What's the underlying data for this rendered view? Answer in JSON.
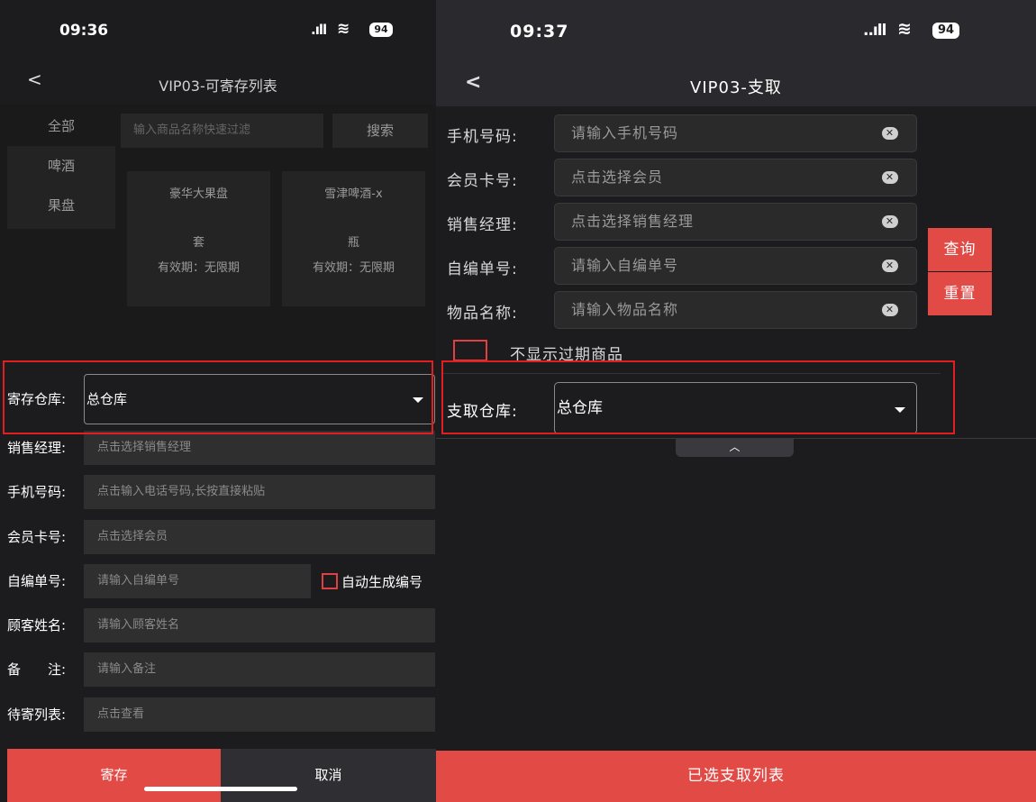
{
  "left": {
    "status": {
      "time": "09:36",
      "signal": ".ıll",
      "wifi": "wifi",
      "battery": "94"
    },
    "nav": {
      "back": "<",
      "title": "VIP03-可寄存列表"
    },
    "categories": [
      "全部",
      "啤酒",
      "果盘"
    ],
    "search": {
      "placeholder": "输入商品名称快速过滤",
      "button": "搜索"
    },
    "cards": [
      {
        "name": "豪华大果盘",
        "unit": "套",
        "expiry": "有效期：无限期"
      },
      {
        "name": "雪津啤酒-x",
        "unit": "瓶",
        "expiry": "有效期：无限期"
      }
    ],
    "warehouse": {
      "label": "寄存仓库:",
      "value": "总仓库"
    },
    "fields": [
      {
        "label": "销售经理:",
        "placeholder": "点击选择销售经理"
      },
      {
        "label": "手机号码:",
        "placeholder": "点击输入电话号码,长按直接粘贴"
      },
      {
        "label": "会员卡号:",
        "placeholder": "点击选择会员"
      },
      {
        "label": "自编单号:",
        "placeholder": "请输入自编单号"
      },
      {
        "label": "顾客姓名:",
        "placeholder": "请输入顾客姓名"
      },
      {
        "label": "备　　注:",
        "placeholder": "请输入备注"
      },
      {
        "label": "待寄列表:",
        "placeholder": "点击查看"
      }
    ],
    "auto_number": "自动生成编号",
    "buttons": {
      "save": "寄存",
      "cancel": "取消"
    }
  },
  "right": {
    "status": {
      "time": "09:37",
      "signal": "..ıll",
      "wifi": "wifi",
      "battery": "94"
    },
    "nav": {
      "back": "<",
      "title": "VIP03-支取"
    },
    "fields": [
      {
        "label": "手机号码:",
        "placeholder": "请输入手机号码"
      },
      {
        "label": "会员卡号:",
        "placeholder": "点击选择会员"
      },
      {
        "label": "销售经理:",
        "placeholder": "点击选择销售经理"
      },
      {
        "label": "自编单号:",
        "placeholder": "请输入自编单号"
      },
      {
        "label": "物品名称:",
        "placeholder": "请输入物品名称"
      }
    ],
    "query_button": "查询",
    "reset_button": "重置",
    "hide_expired": "不显示过期商品",
    "warehouse": {
      "label": "支取仓库:",
      "value": "总仓库"
    },
    "collapse_icon": "chevron-up-icon",
    "bottom_button": "已选支取列表"
  },
  "colors": {
    "accent": "#e24a46",
    "highlight": "#e02020",
    "bg": "#1c1c1e"
  }
}
